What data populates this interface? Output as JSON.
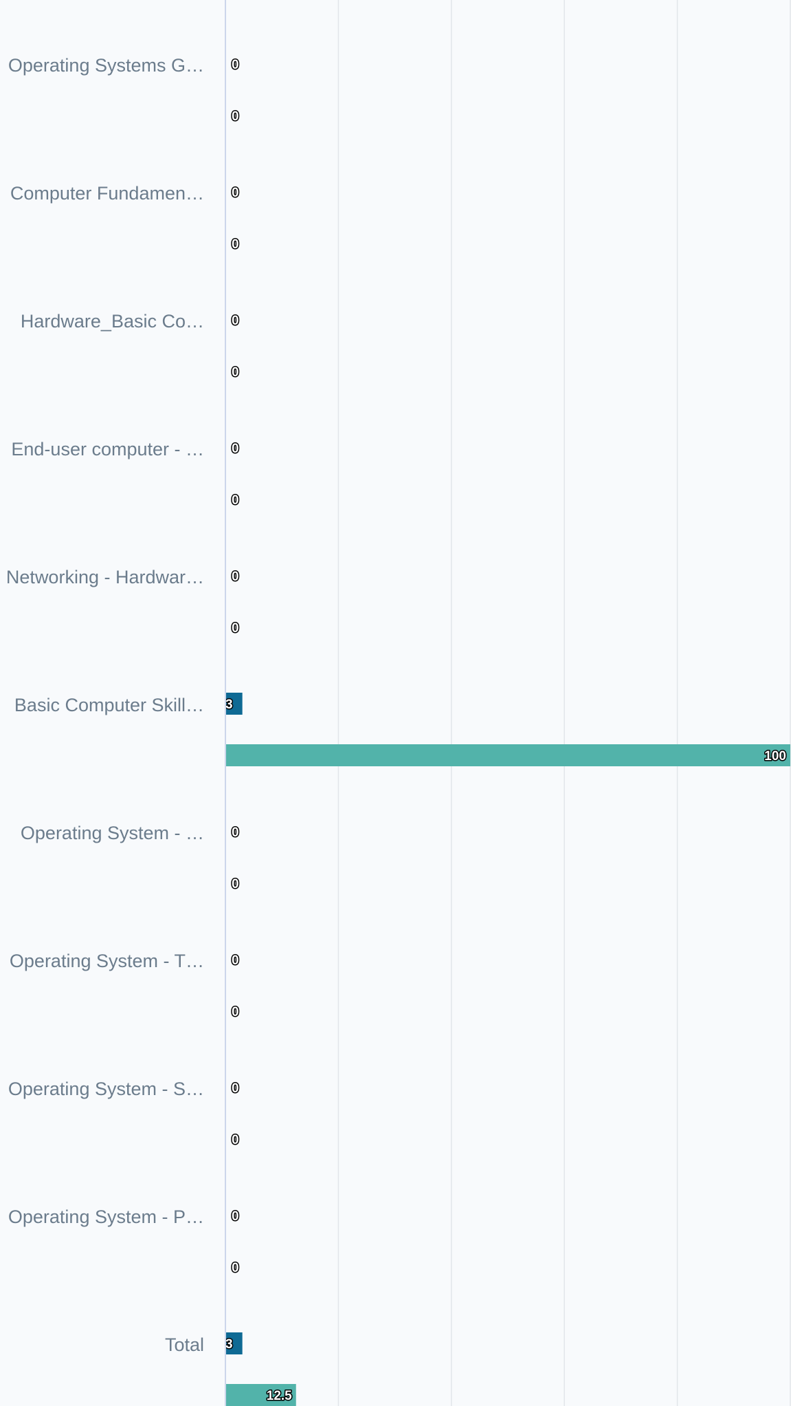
{
  "chart_data": {
    "type": "bar",
    "orientation": "horizontal",
    "categories": [
      "Operating Systems G…",
      "Computer Fundamen…",
      "Hardware_Basic Co…",
      "End-user computer - …",
      "Networking - Hardwar…",
      "Basic Computer Skill…",
      "Operating System - …",
      "Operating System - T…",
      "Operating System - S…",
      "Operating System - P…",
      "Total"
    ],
    "series": [
      {
        "color": "#0f6a94",
        "values": [
          0,
          0,
          0,
          0,
          0,
          3,
          0,
          0,
          0,
          0,
          3
        ]
      },
      {
        "color": "#52b3aa",
        "values": [
          0,
          0,
          0,
          0,
          0,
          100,
          0,
          0,
          0,
          0,
          12.5
        ]
      }
    ],
    "value_labels": [
      [
        "0",
        "0",
        "0",
        "0",
        "0",
        "3",
        "0",
        "0",
        "0",
        "0",
        "3"
      ],
      [
        "0",
        "0",
        "0",
        "0",
        "0",
        "100",
        "0",
        "0",
        "0",
        "0",
        "12.5"
      ]
    ],
    "xlim": [
      0,
      100
    ],
    "grid": true,
    "colors": {
      "gridline": "#e2e6ea",
      "axis": "#ccd6eb",
      "label": "#6b7c8c"
    }
  }
}
